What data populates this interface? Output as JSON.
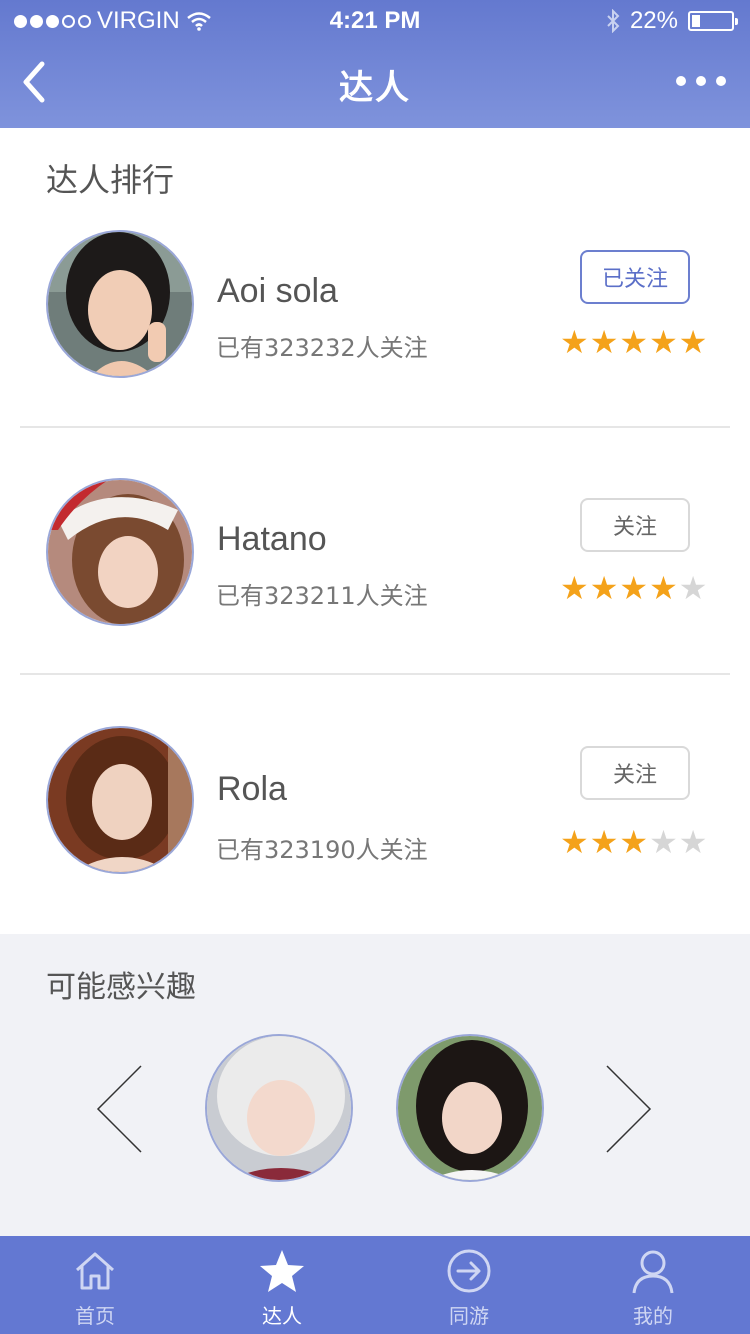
{
  "status_bar": {
    "carrier": "VIRGIN",
    "signal_level": 3,
    "time": "4:21 PM",
    "battery": "22%",
    "battery_level": 0.22
  },
  "nav": {
    "title": "达人",
    "back_icon": "chevron-left-icon",
    "more_icon": "more-dots-icon"
  },
  "ranking": {
    "title": "达人排行",
    "items": [
      {
        "name": "Aoi sola",
        "followers": "已有323232人关注",
        "button": "已关注",
        "following": true,
        "rating": 5,
        "max_rating": 5
      },
      {
        "name": "Hatano",
        "followers": "已有323211人关注",
        "button": "关注",
        "following": false,
        "rating": 4,
        "max_rating": 5
      },
      {
        "name": "Rola",
        "followers": "已有323190人关注",
        "button": "关注",
        "following": false,
        "rating": 3,
        "max_rating": 5
      }
    ]
  },
  "interest": {
    "title": "可能感兴趣",
    "prev_icon": "chevron-left-icon",
    "next_icon": "chevron-right-icon"
  },
  "tabbar": {
    "tabs": [
      {
        "label": "首页",
        "icon": "home-icon",
        "active": false
      },
      {
        "label": "达人",
        "icon": "star-icon",
        "active": true
      },
      {
        "label": "同游",
        "icon": "arrow-circle-icon",
        "active": false
      },
      {
        "label": "我的",
        "icon": "user-icon",
        "active": false
      }
    ]
  },
  "colors": {
    "accent": "#6378d2",
    "star": "#f4a21a",
    "star_empty": "#d6d6d6"
  }
}
